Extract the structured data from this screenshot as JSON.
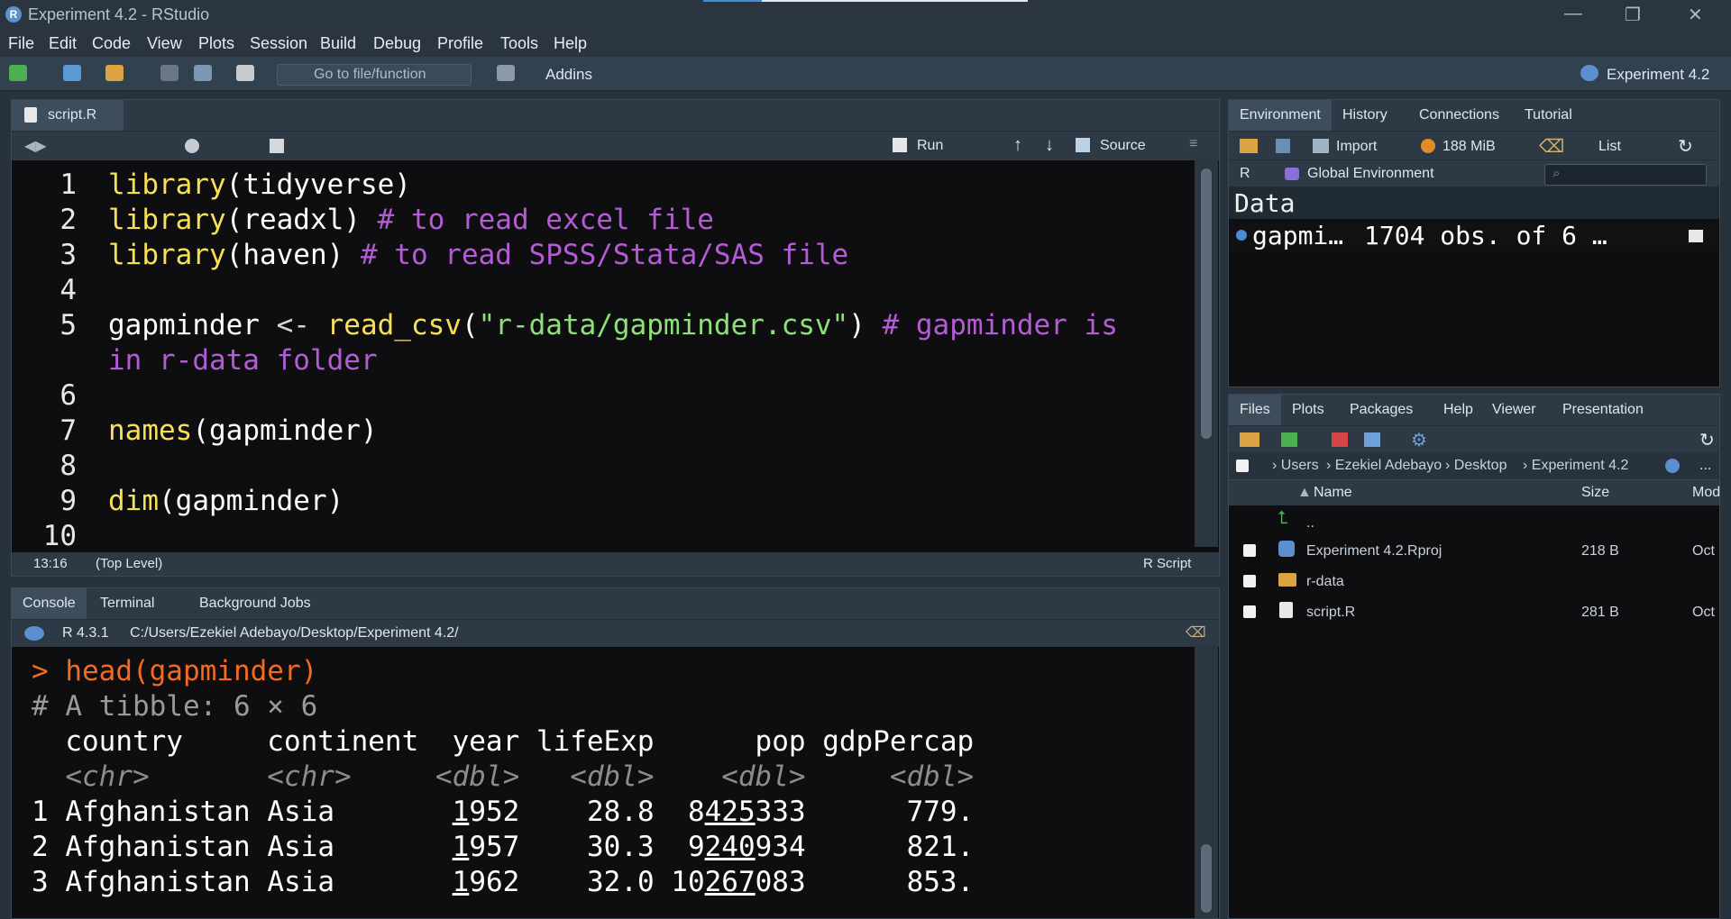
{
  "window": {
    "title": "Experiment 4.2 - RStudio",
    "min": "—",
    "max": "❐",
    "close": "✕"
  },
  "menu": [
    "File",
    "Edit",
    "Code",
    "View",
    "Plots",
    "Session",
    "Build",
    "Debug",
    "Profile",
    "Tools",
    "Help"
  ],
  "toolbar": {
    "goto_placeholder": "Go to file/function",
    "addins": "Addins",
    "project": "Experiment 4.2"
  },
  "editor": {
    "tab": "script.R",
    "run": "Run",
    "source": "Source",
    "lines": [
      {
        "n": "1"
      },
      {
        "n": "2"
      },
      {
        "n": "3"
      },
      {
        "n": "4"
      },
      {
        "n": "5"
      },
      {
        "n": "6"
      },
      {
        "n": "7"
      },
      {
        "n": "8"
      },
      {
        "n": "9"
      },
      {
        "n": "10"
      }
    ],
    "code": {
      "l1a": "library",
      "l1b": "(tidyverse)",
      "l2a": "library",
      "l2b": "(readxl) ",
      "l2c": "# to read excel file",
      "l3a": "library",
      "l3b": "(haven) ",
      "l3c": "# to read SPSS/Stata/SAS file",
      "l5a": "gapminder ",
      "l5b": "<- ",
      "l5c": "read_csv",
      "l5d": "(",
      "l5e": "\"r-data/gapminder.csv\"",
      "l5f": ") ",
      "l5g": "# gapminder is",
      "l5h": "in r-data folder",
      "l7a": "names",
      "l7b": "(gapminder)",
      "l9a": "dim",
      "l9b": "(gapminder)"
    },
    "status": {
      "pos": "13:16",
      "scope": "(Top Level)",
      "type": "R Script"
    }
  },
  "console": {
    "tabs": [
      "Console",
      "Terminal",
      "Background Jobs"
    ],
    "rversion": "R 4.3.1",
    "path": "C:/Users/Ezekiel Adebayo/Desktop/Experiment 4.2/",
    "prompt": "> ",
    "cmd": "head(gapminder)",
    "tibble": "# A tibble: 6 × 6",
    "header": "  country     continent  year lifeExp      pop gdpPercap",
    "types": "  <chr>       <chr>     <dbl>   <dbl>    <dbl>     <dbl>",
    "rows": [
      {
        "i": "1",
        "country": "Afghanistan",
        "continent": "Asia",
        "y1": "1",
        "y2": "952",
        "life": "28.8",
        "p1": "8",
        "p2": "425",
        "p3": "333",
        "gdp": "779."
      },
      {
        "i": "2",
        "country": "Afghanistan",
        "continent": "Asia",
        "y1": "1",
        "y2": "957",
        "life": "30.3",
        "p1": "9",
        "p2": "240",
        "p3": "934",
        "gdp": "821."
      },
      {
        "i": "3",
        "country": "Afghanistan",
        "continent": "Asia",
        "y1": "1",
        "y2": "962",
        "life": "32.0",
        "p1": "10",
        "p2": "267",
        "p3": "083",
        "gdp": "853."
      }
    ]
  },
  "env": {
    "tabs": [
      "Environment",
      "History",
      "Connections",
      "Tutorial"
    ],
    "import": "Import",
    "memory": "188 MiB",
    "list": "List",
    "lang": "R",
    "scope": "Global Environment",
    "section": "Data",
    "var_name": "gapmi…",
    "var_desc": "1704 obs. of 6 …"
  },
  "files": {
    "tabs": [
      "Files",
      "Plots",
      "Packages",
      "Help",
      "Viewer",
      "Presentation"
    ],
    "breadcrumb": [
      "Users",
      "Ezekiel Adebayo",
      "Desktop",
      "Experiment 4.2"
    ],
    "more": "...",
    "cols": {
      "name": "Name",
      "size": "Size",
      "mod": "Mod"
    },
    "up": "..",
    "items": [
      {
        "name": "Experiment 4.2.Rproj",
        "size": "218 B",
        "mod": "Oct"
      },
      {
        "name": "r-data",
        "size": "",
        "mod": ""
      },
      {
        "name": "script.R",
        "size": "281 B",
        "mod": "Oct"
      }
    ]
  }
}
